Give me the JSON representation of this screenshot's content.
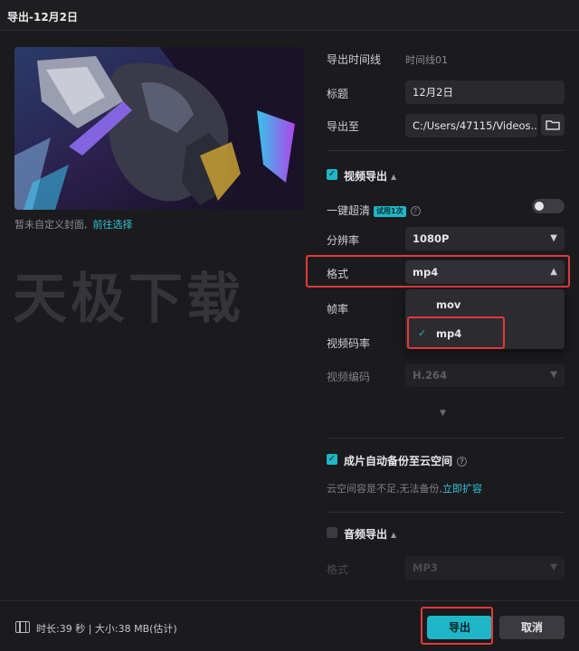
{
  "window": {
    "title": "导出-12月2日"
  },
  "cover": {
    "hint": "暂未自定义封面,",
    "link": "前往选择"
  },
  "watermark": "天极下载",
  "form": {
    "timeline_label": "导出时间线",
    "timeline_value": "时间线01",
    "title_label": "标题",
    "title_value": "12月2日",
    "export_to_label": "导出至",
    "export_to_value": "C:/Users/47115/Videos...",
    "video_section": "视频导出",
    "enhance_label": "一键超清",
    "enhance_badge": "试用1次",
    "resolution_label": "分辨率",
    "resolution_value": "1080P",
    "format_label": "格式",
    "format_value": "mp4",
    "fps_label": "帧率",
    "bitrate_label": "视频码率",
    "codec_label": "视频编码",
    "codec_value": "H.264",
    "backup_label": "成片自动备份至云空间",
    "cloud_note": "云空间容是不足,无法备份,",
    "cloud_link": "立即扩容",
    "audio_section": "音频导出",
    "audio_format_label": "格式",
    "audio_format_value": "MP3"
  },
  "format_dropdown": {
    "options": [
      "mov",
      "mp4"
    ],
    "selected": "mp4"
  },
  "footer": {
    "info": "时长:39 秒 | 大小:38 MB(估计)",
    "export_button": "导出",
    "cancel_button": "取消"
  },
  "colors": {
    "accent": "#1fb6c8",
    "highlight": "#e03a3a",
    "background": "#1b1b1e"
  }
}
